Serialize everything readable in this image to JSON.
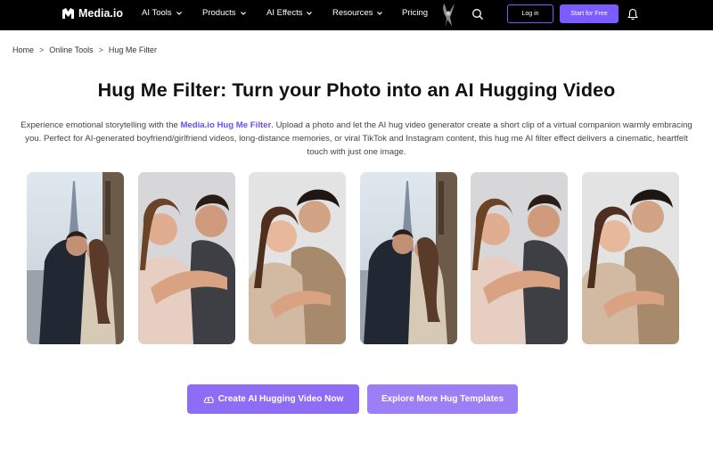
{
  "brand": {
    "name": "Media.io",
    "accent": "#7b5cff"
  },
  "nav": {
    "items": [
      {
        "label": "AI Tools",
        "dropdown": true
      },
      {
        "label": "Products",
        "dropdown": true
      },
      {
        "label": "AI Effects",
        "dropdown": true
      },
      {
        "label": "Resources",
        "dropdown": true
      },
      {
        "label": "Pricing",
        "dropdown": false
      }
    ],
    "login_label": "Log in",
    "start_label": "Start for Free"
  },
  "breadcrumb": [
    "Home",
    "Online Tools",
    "Hug Me Filter"
  ],
  "page": {
    "title": "Hug Me Filter: Turn your Photo into an AI Hugging Video",
    "desc_pre": "Experience emotional storytelling with the ",
    "desc_link": "Media.io Hug Me Filter",
    "desc_post": ". Upload a photo and let the AI hug video generator create a short clip of a virtual companion warmly embracing you. Perfect for AI-generated boyfriend/girlfriend videos, long-distance memories, or viral TikTok and Instagram content, this hug me AI filter effect delivers a cinematic, heartfelt touch with just one image."
  },
  "gallery": [
    {
      "scene": "paris-kiss"
    },
    {
      "scene": "couple-smile"
    },
    {
      "scene": "couple-kiss-cheek"
    },
    {
      "scene": "paris-kiss"
    },
    {
      "scene": "couple-smile"
    },
    {
      "scene": "couple-kiss-cheek"
    }
  ],
  "cta": {
    "primary_label": "Create AI Hugging Video Now",
    "secondary_label": "Explore More Hug Templates"
  }
}
